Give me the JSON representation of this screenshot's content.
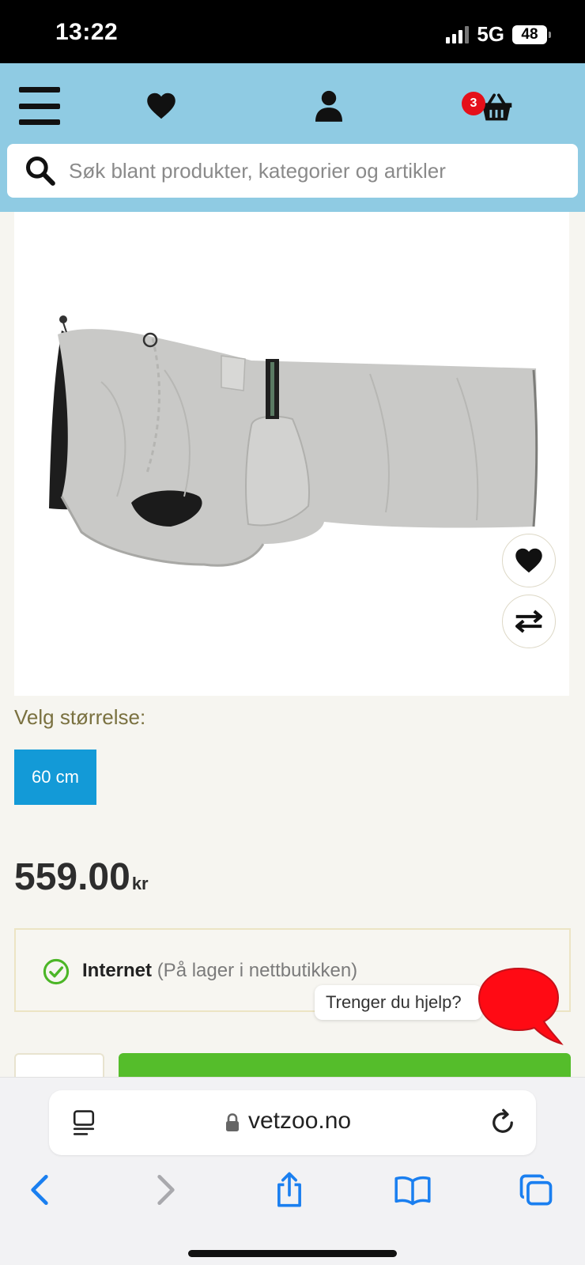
{
  "status_bar": {
    "time": "13:22",
    "network": "5G",
    "battery": "48"
  },
  "header": {
    "cart_count": "3",
    "search_placeholder": "Søk blant produkter, kategorier og artikler"
  },
  "product": {
    "size_label": "Velg størrelse:",
    "sizes": [
      "60 cm"
    ],
    "selected_size": "60 cm",
    "price": "559.00",
    "currency": "kr",
    "stock": {
      "channel": "Internet",
      "status": "(På lager i nettbutikken)"
    }
  },
  "help": {
    "bubble_text": "Trenger du hjelp?"
  },
  "browser": {
    "url": "vetzoo.no"
  },
  "colors": {
    "header_bg": "#8fcbe3",
    "accent_blue": "#139ad7",
    "cart_badge": "#e5101a",
    "add_to_cart_green": "#55bd2b",
    "chat_red": "#ff0a14"
  }
}
